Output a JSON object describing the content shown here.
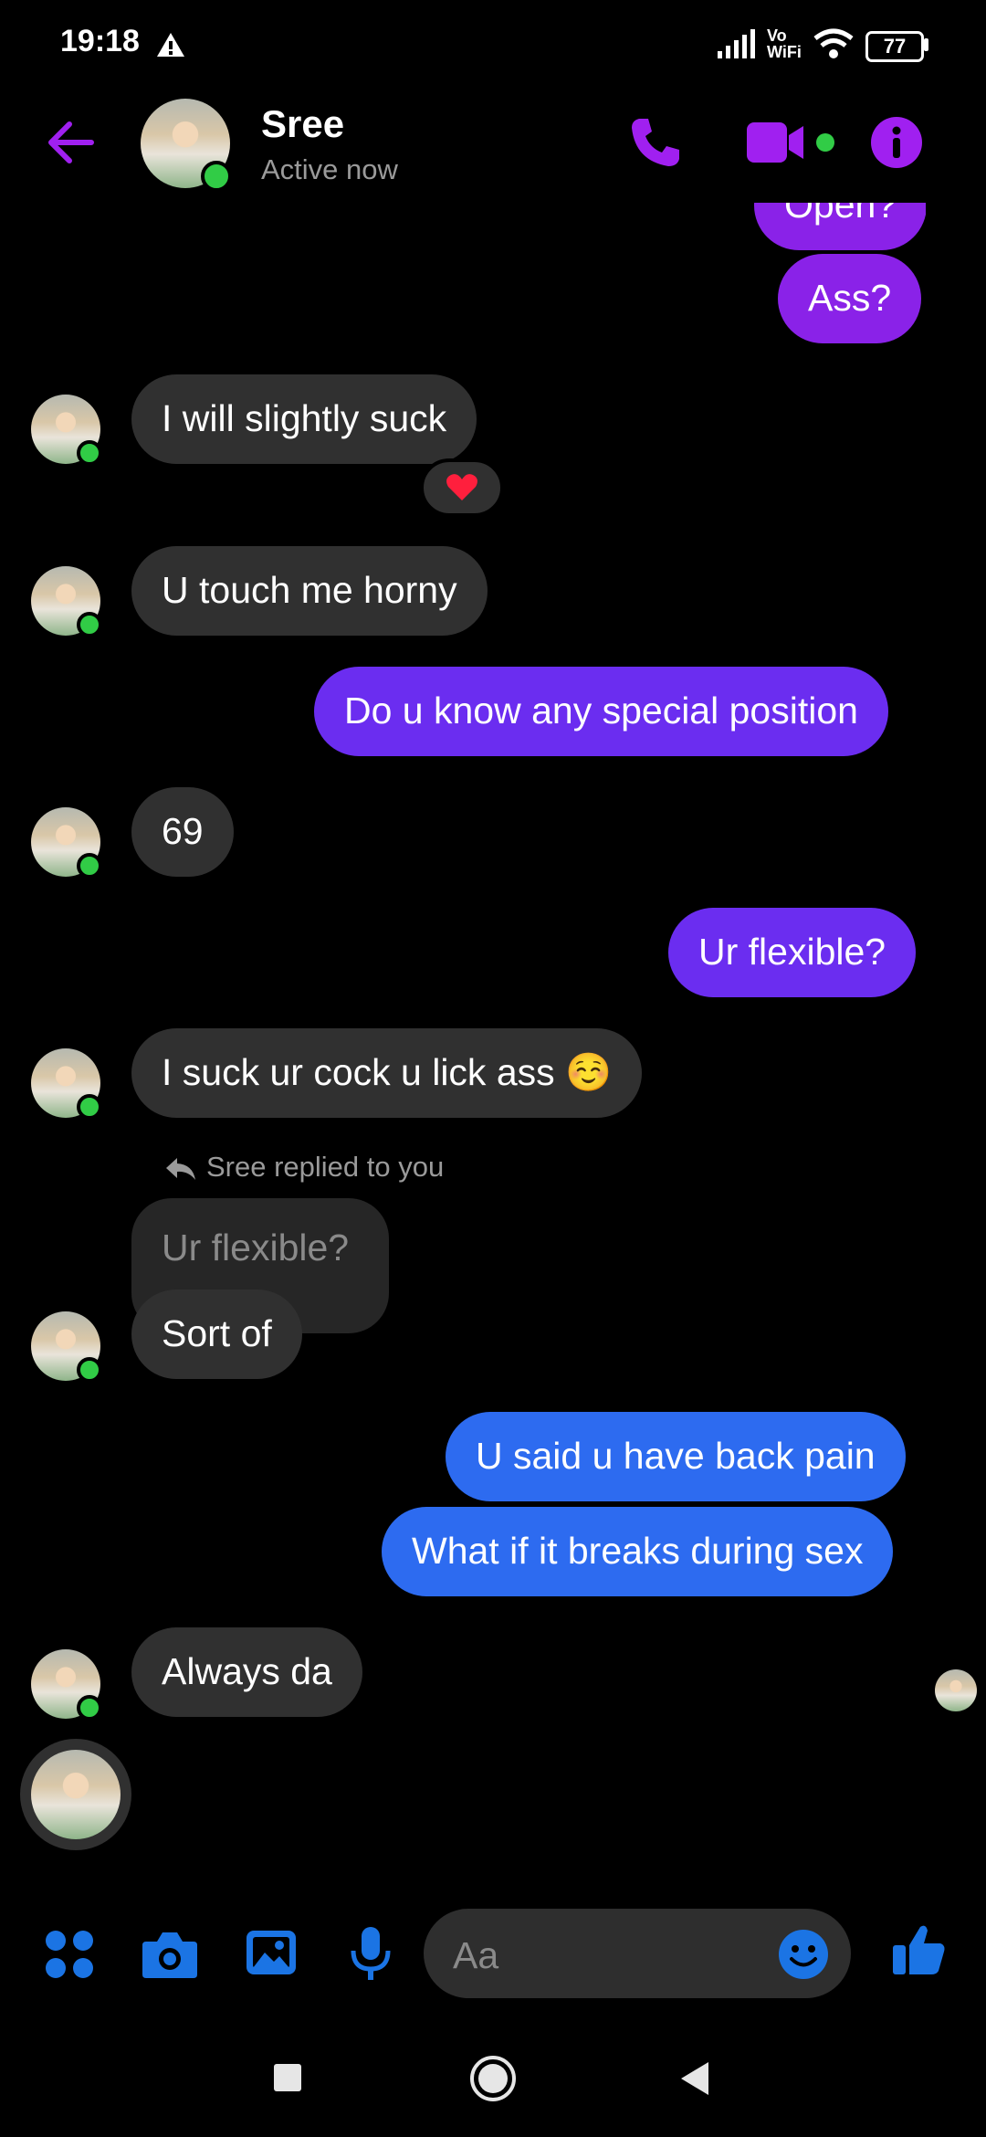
{
  "status_bar": {
    "time": "19:18",
    "battery": "77"
  },
  "header": {
    "name": "Sree",
    "subtitle": "Active now"
  },
  "messages": [
    {
      "text": "Open?"
    },
    {
      "text": "Ass?"
    },
    {
      "text": "I will slightly suck",
      "reaction": "❤️"
    },
    {
      "text": "U touch me horny"
    },
    {
      "text": "Do u know any special position"
    },
    {
      "text": "69"
    },
    {
      "text": "Ur flexible?"
    },
    {
      "text": "I suck ur cock u lick ass ☺️"
    },
    {
      "reply_note": "Sree replied to you",
      "quoted": "Ur flexible?",
      "text": "Sort of"
    },
    {
      "text": "U said u have back pain"
    },
    {
      "text": "What if it breaks during sex"
    },
    {
      "text": "Always da"
    }
  ],
  "composer": {
    "placeholder": "Aa"
  },
  "colors": {
    "accent": "#a020f0",
    "blue": "#1b74e4",
    "incoming": "#303030"
  },
  "icons": {
    "back": "arrow-left",
    "call": "phone",
    "video": "video-camera",
    "info": "info",
    "apps": "grid-dots",
    "camera": "camera",
    "gallery": "image",
    "mic": "microphone",
    "emoji": "smiley",
    "like": "thumbs-up"
  }
}
